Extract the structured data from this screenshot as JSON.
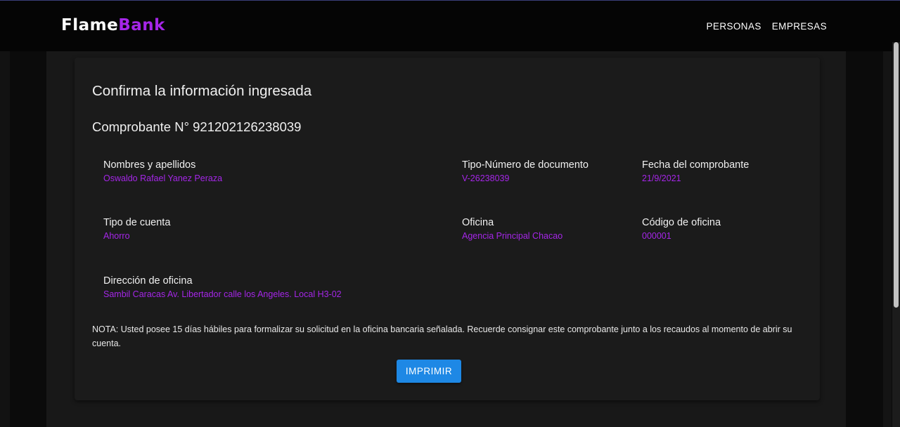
{
  "brand": {
    "part1": "Flame",
    "part2": "Bank",
    "accent_color": "#a526e8"
  },
  "nav": {
    "items": [
      {
        "label": "PERSONAS"
      },
      {
        "label": "EMPRESAS"
      }
    ]
  },
  "card": {
    "title": "Confirma la información ingresada",
    "voucher": "Comprobante N° 921202126238039",
    "fields": {
      "names": {
        "label": "Nombres y apellidos",
        "value": "Oswaldo Rafael Yanez Peraza"
      },
      "document": {
        "label": "Tipo-Número de documento",
        "value": "V-26238039"
      },
      "date": {
        "label": "Fecha del comprobante",
        "value": "21/9/2021"
      },
      "account_type": {
        "label": "Tipo de cuenta",
        "value": "Ahorro"
      },
      "office": {
        "label": "Oficina",
        "value": "Agencia Principal Chacao"
      },
      "office_code": {
        "label": "Código de oficina",
        "value": "000001"
      },
      "office_address": {
        "label": "Dirección de oficina",
        "value": "Sambil Caracas Av. Libertador calle los Angeles. Local H3-02"
      }
    },
    "note": "NOTA: Usted posee 15 días hábiles para formalizar su solicitud en la oficina bancaria señalada. Recuerde consignar este comprobante junto a los recaudos al momento de abrir su cuenta.",
    "print_button": "IMPRIMIR",
    "print_button_color": "#1e88e5"
  }
}
